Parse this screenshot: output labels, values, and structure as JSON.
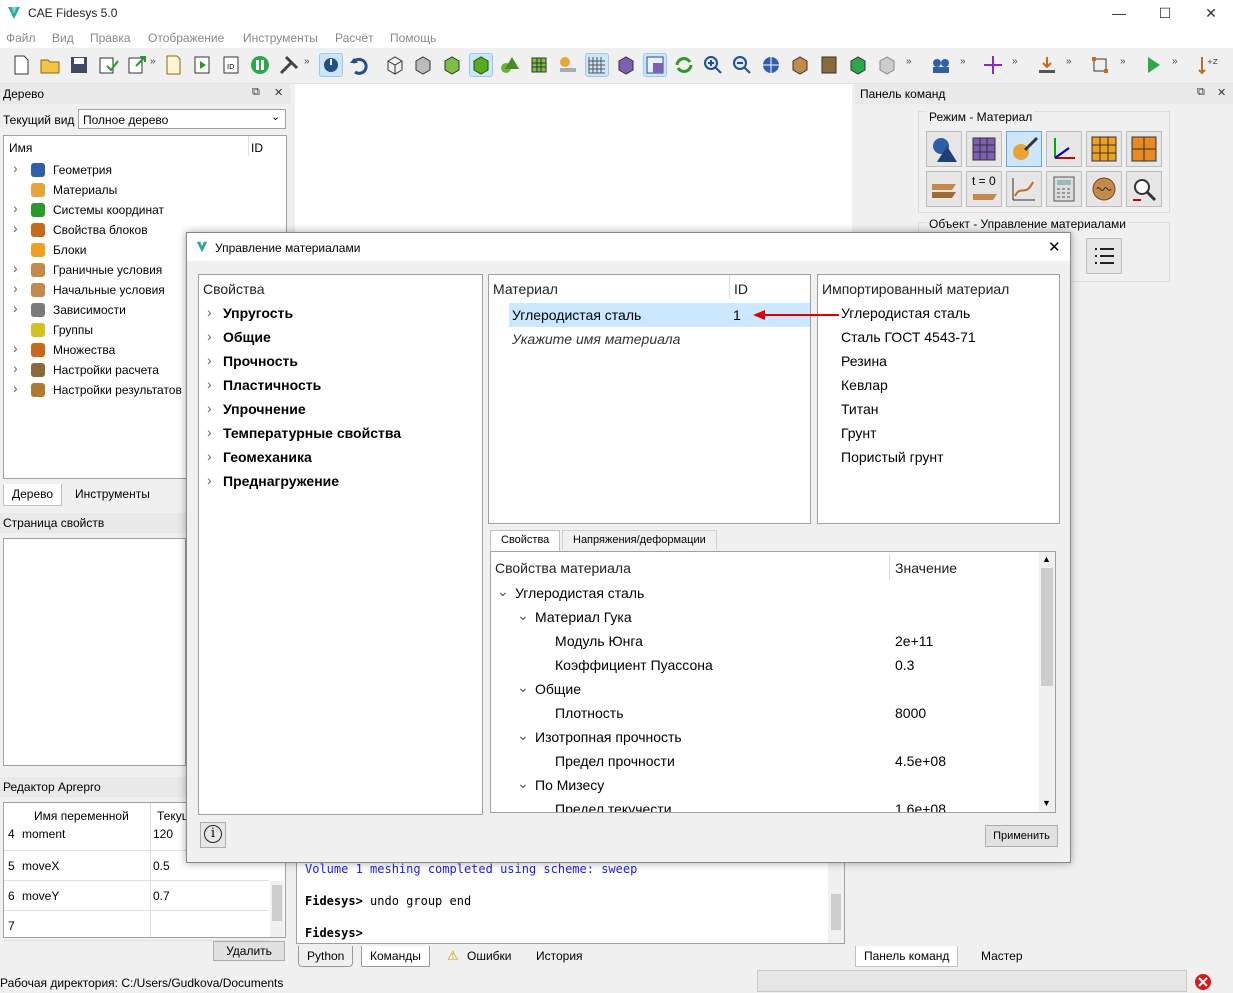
{
  "app": {
    "title": "CAE Fidesys 5.0",
    "window_controls": [
      "—",
      "☐",
      "✕"
    ]
  },
  "menu": [
    "Файл",
    "Вид",
    "Правка",
    "Отображение",
    "Инструменты",
    "Расчёт",
    "Помощь"
  ],
  "toolbar": {
    "overflow_glyph": "»",
    "icons": [
      "new-file-icon",
      "open-folder-icon",
      "save-icon",
      "save-as-icon",
      "export-icon",
      "script-icon",
      "run-script-icon",
      "journal-icon",
      "pause-icon",
      "tools-icon",
      "select-icon",
      "undo-icon",
      "wireframe-cube-icon",
      "hidden-cube-icon",
      "shaded-cube-icon",
      "solid-cube-icon",
      "geometry-icon",
      "mesh-cube-icon",
      "bc-icon",
      "grid-icon",
      "view-cube-icon",
      "window-icon",
      "refresh-icon",
      "zoom-in-icon",
      "zoom-out-icon",
      "pan-icon",
      "box-icon",
      "texture-icon",
      "green-cube-icon",
      "gray-cube-icon",
      "group-icon",
      "axis-icon",
      "measure-icon",
      "transform-icon",
      "run-icon",
      "sort-icon"
    ]
  },
  "tree_panel": {
    "title": "Дерево",
    "view_label": "Текущий вид",
    "view_value": "Полное дерево",
    "col_name": "Имя",
    "col_id": "ID",
    "items": [
      {
        "label": "Геометрия",
        "expandable": true,
        "icon": "geometry-icon"
      },
      {
        "label": "Материалы",
        "expandable": false,
        "icon": "materials-icon"
      },
      {
        "label": "Системы координат",
        "expandable": true,
        "icon": "coordinate-system-icon"
      },
      {
        "label": "Свойства блоков",
        "expandable": true,
        "icon": "block-properties-icon"
      },
      {
        "label": "Блоки",
        "expandable": false,
        "icon": "blocks-icon"
      },
      {
        "label": "Граничные условия",
        "expandable": true,
        "icon": "boundary-conditions-icon"
      },
      {
        "label": "Начальные условия",
        "expandable": true,
        "icon": "initial-conditions-icon"
      },
      {
        "label": "Зависимости",
        "expandable": true,
        "icon": "dependencies-icon"
      },
      {
        "label": "Группы",
        "expandable": false,
        "icon": "groups-icon"
      },
      {
        "label": "Множества",
        "expandable": true,
        "icon": "sets-icon"
      },
      {
        "label": "Настройки расчета",
        "expandable": true,
        "icon": "calc-settings-icon"
      },
      {
        "label": "Настройки результатов",
        "expandable": true,
        "icon": "results-settings-icon"
      }
    ],
    "tabs": [
      "Дерево",
      "Инструменты"
    ]
  },
  "property_page": {
    "title": "Страница свойств"
  },
  "aprepro": {
    "title": "Редактор Aprepro",
    "col_name": "Имя переменной",
    "col_value": "Текущ",
    "rows": [
      {
        "num": "4",
        "name": "moment",
        "value": "120"
      },
      {
        "num": "5",
        "name": "moveX",
        "value": "0.5"
      },
      {
        "num": "6",
        "name": "moveY",
        "value": "0.7"
      },
      {
        "num": "7",
        "name": "",
        "value": ""
      }
    ],
    "delete_button": "Удалить"
  },
  "command_panel": {
    "title": "Панель команд",
    "mode_label": "Режим - Материал",
    "object_label": "Объект - Управление материалами",
    "mode_icon_text": "t = 0",
    "tabs": [
      "Панель команд",
      "Мастер"
    ]
  },
  "dialog": {
    "title": "Управление материалами",
    "close": "✕",
    "properties_header": "Свойства",
    "property_groups": [
      "Упругость",
      "Общие",
      "Прочность",
      "Пластичность",
      "Упрочнение",
      "Температурные свойства",
      "Геомеханика",
      "Преднагружение"
    ],
    "material_header": "Материал",
    "id_header": "ID",
    "materials": [
      {
        "name": "Углеродистая сталь",
        "id": "1"
      }
    ],
    "new_material_placeholder": "Укажите имя материала",
    "imported_header": "Импортированный материал",
    "imported": [
      "Углеродистая сталь",
      "Сталь ГОСТ 4543-71",
      "Резина",
      "Кевлар",
      "Титан",
      "Грунт",
      "Пористый грунт"
    ],
    "tabs": [
      "Свойства",
      "Напряжения/деформации"
    ],
    "table_col_property": "Свойства материала",
    "table_col_value": "Значение",
    "table_rows": [
      {
        "level": 0,
        "expand": true,
        "label": "Углеродистая сталь",
        "value": ""
      },
      {
        "level": 1,
        "expand": true,
        "label": "Материал Гука",
        "value": ""
      },
      {
        "level": 2,
        "expand": false,
        "label": "Модуль Юнга",
        "value": "2e+11"
      },
      {
        "level": 2,
        "expand": false,
        "label": "Коэффициент Пуассона",
        "value": "0.3"
      },
      {
        "level": 1,
        "expand": true,
        "label": "Общие",
        "value": ""
      },
      {
        "level": 2,
        "expand": false,
        "label": "Плотность",
        "value": "8000"
      },
      {
        "level": 1,
        "expand": true,
        "label": "Изотропная прочность",
        "value": ""
      },
      {
        "level": 2,
        "expand": false,
        "label": "Предел прочности",
        "value": "4.5e+08"
      },
      {
        "level": 1,
        "expand": true,
        "label": "По Мизесу",
        "value": ""
      },
      {
        "level": 2,
        "expand": false,
        "label": "Предел текучести",
        "value": "1.6e+08"
      }
    ],
    "info_icon": "i",
    "apply_button": "Применить"
  },
  "console": {
    "lines": [
      {
        "text": "Volume 1 meshing completed using scheme: sweep",
        "color": "#1a1aff"
      },
      {
        "prompt": "Fidesys>",
        "text": " undo group end"
      },
      {
        "prompt": "Fidesys>",
        "text": ""
      }
    ],
    "tabs": [
      "Python",
      "Команды",
      "Ошибки",
      "История"
    ]
  },
  "status": {
    "workdir": "Рабочая директория: C:/Users/Gudkova/Documents"
  },
  "colors": {
    "accent": "#0078d7",
    "selection": "#cce8ff",
    "arrow": "#e00000",
    "console_blue": "#1a1aff"
  }
}
